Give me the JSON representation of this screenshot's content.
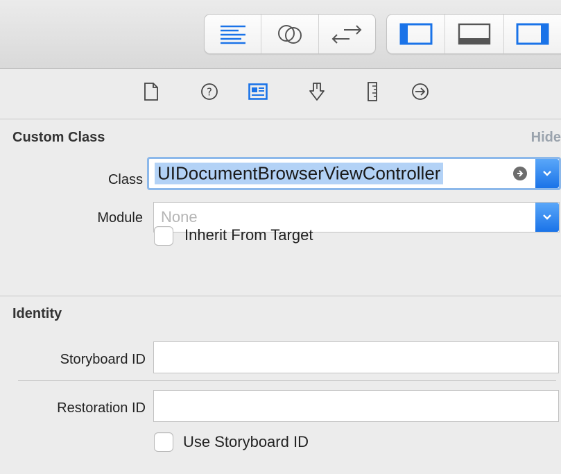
{
  "toolbar": {
    "editor_buttons": [
      {
        "name": "standard-editor-icon"
      },
      {
        "name": "assistant-editor-icon"
      },
      {
        "name": "version-editor-icon"
      }
    ],
    "panel_buttons": [
      {
        "name": "navigator-panel-icon"
      },
      {
        "name": "debug-area-panel-icon"
      },
      {
        "name": "utilities-panel-icon"
      }
    ],
    "accent": "#1a73e8"
  },
  "inspector_tabs": [
    {
      "name": "file-inspector-icon",
      "active": false
    },
    {
      "name": "quick-help-icon",
      "active": false
    },
    {
      "name": "identity-inspector-icon",
      "active": true
    },
    {
      "name": "attributes-inspector-icon",
      "active": false
    },
    {
      "name": "size-inspector-icon",
      "active": false
    },
    {
      "name": "connections-inspector-icon",
      "active": false
    }
  ],
  "custom_class": {
    "title": "Custom Class",
    "hide_label": "Hide",
    "class_label": "Class",
    "class_value": "UIDocumentBrowserViewController",
    "module_label": "Module",
    "module_placeholder": "None",
    "inherit_label": "Inherit From Target",
    "inherit_checked": false
  },
  "identity": {
    "title": "Identity",
    "storyboard_id_label": "Storyboard ID",
    "storyboard_id_value": "",
    "restoration_id_label": "Restoration ID",
    "restoration_id_value": "",
    "use_storyboard_label": "Use Storyboard ID",
    "use_storyboard_checked": false
  }
}
